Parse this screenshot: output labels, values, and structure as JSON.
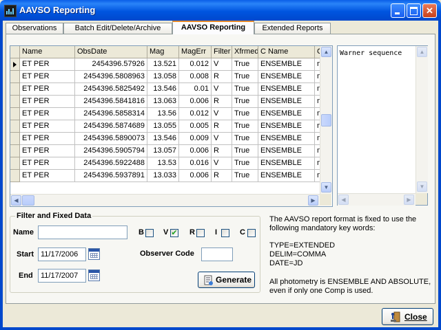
{
  "window": {
    "title": "AAVSO Reporting"
  },
  "tabs": [
    {
      "label": "Observations",
      "active": false
    },
    {
      "label": "Batch Edit/Delete/Archive",
      "active": false
    },
    {
      "label": "AAVSO Reporting",
      "active": true
    },
    {
      "label": "Extended Reports",
      "active": false
    }
  ],
  "grid": {
    "columns": [
      "Name",
      "ObsDate",
      "Mag",
      "MagErr",
      "Filter",
      "Xfrmed",
      "C Name",
      "CM"
    ],
    "selected_row": 0,
    "rows": [
      [
        "ET PER",
        "2454396.57926",
        "13.521",
        "0.012",
        "V",
        "True",
        "ENSEMBLE",
        "na"
      ],
      [
        "ET PER",
        "2454396.5808963",
        "13.058",
        "0.008",
        "R",
        "True",
        "ENSEMBLE",
        "na"
      ],
      [
        "ET PER",
        "2454396.5825492",
        "13.546",
        "0.01",
        "V",
        "True",
        "ENSEMBLE",
        "na"
      ],
      [
        "ET PER",
        "2454396.5841816",
        "13.063",
        "0.006",
        "R",
        "True",
        "ENSEMBLE",
        "na"
      ],
      [
        "ET PER",
        "2454396.5858314",
        "13.56",
        "0.012",
        "V",
        "True",
        "ENSEMBLE",
        "na"
      ],
      [
        "ET PER",
        "2454396.5874689",
        "13.055",
        "0.005",
        "R",
        "True",
        "ENSEMBLE",
        "na"
      ],
      [
        "ET PER",
        "2454396.5890073",
        "13.546",
        "0.009",
        "V",
        "True",
        "ENSEMBLE",
        "na"
      ],
      [
        "ET PER",
        "2454396.5905794",
        "13.057",
        "0.006",
        "R",
        "True",
        "ENSEMBLE",
        "na"
      ],
      [
        "ET PER",
        "2454396.5922488",
        "13.53",
        "0.016",
        "V",
        "True",
        "ENSEMBLE",
        "na"
      ],
      [
        "ET PER",
        "2454396.5937891",
        "13.033",
        "0.006",
        "R",
        "True",
        "ENSEMBLE",
        "na"
      ]
    ]
  },
  "notes": {
    "text": "Warner sequence"
  },
  "filter": {
    "title": "Filter and Fixed Data",
    "name_label": "Name",
    "name_value": "",
    "checkboxes": [
      {
        "label": "B",
        "checked": false
      },
      {
        "label": "V",
        "checked": true
      },
      {
        "label": "R",
        "checked": false
      },
      {
        "label": "I",
        "checked": false
      },
      {
        "label": "C",
        "checked": false
      }
    ],
    "start_label": "Start",
    "start_value": "11/17/2006",
    "end_label": "End",
    "end_value": "11/17/2007",
    "observer_label": "Observer Code",
    "observer_value": "",
    "generate_label": "Generate"
  },
  "info": {
    "line1": "The AAVSO report format is fixed to use the",
    "line2": "following mandatory key words:",
    "kw1": "TYPE=EXTENDED",
    "kw2": "DELIM=COMMA",
    "kw3": "DATE=JD",
    "note1": "All photometry is ENSEMBLE AND ABSOLUTE,",
    "note2": "even if only one Comp is used."
  },
  "close_label": "Close",
  "colors": {
    "titlebar": "#0055e0",
    "active_tab_accent": "#e68b2c",
    "check": "#21a121"
  }
}
